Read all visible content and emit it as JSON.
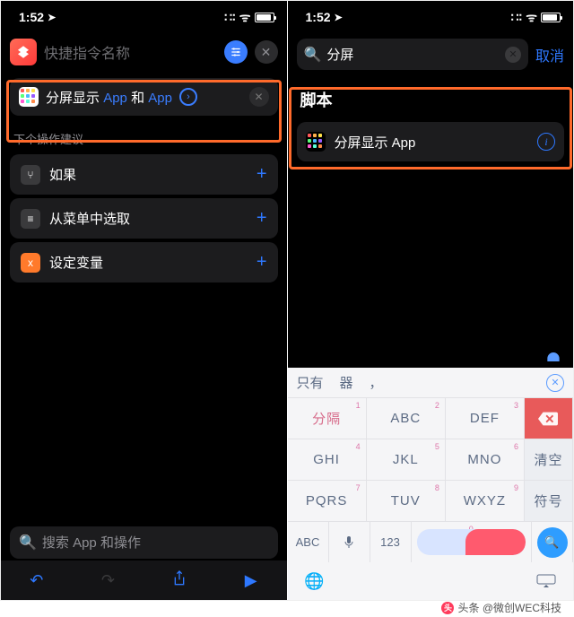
{
  "status": {
    "time": "1:52",
    "loc_icon": "➤"
  },
  "left": {
    "shortcut_name_placeholder": "快捷指令名称",
    "action": {
      "prefix": "分屏显示",
      "token": "App",
      "join": "和"
    },
    "suggest_label": "下个操作建议",
    "suggestions": [
      {
        "label": "如果",
        "color": "#3a3a3c"
      },
      {
        "label": "从菜单中选取",
        "color": "#3a3a3c"
      },
      {
        "label": "设定变量",
        "color": "#ff7a2b"
      }
    ],
    "search_placeholder": "搜索 App 和操作"
  },
  "right": {
    "search_value": "分屏",
    "cancel": "取消",
    "category": "脚本",
    "result": "分屏显示 App",
    "candidates": [
      "只有",
      "器",
      "，"
    ],
    "keys_row1": [
      {
        "num": "1",
        "main": "分隔",
        "pink": true
      },
      {
        "num": "2",
        "main": "ABC"
      },
      {
        "num": "3",
        "main": "DEF"
      }
    ],
    "keys_row2": [
      {
        "num": "4",
        "main": "GHI"
      },
      {
        "num": "5",
        "main": "JKL"
      },
      {
        "num": "6",
        "main": "MNO"
      }
    ],
    "side2": "清空",
    "keys_row3": [
      {
        "num": "7",
        "main": "PQRS"
      },
      {
        "num": "8",
        "main": "TUV"
      },
      {
        "num": "9",
        "main": "WXYZ"
      }
    ],
    "side3": "符号",
    "bottom": {
      "abc": "ABC",
      "num": "123",
      "zero": "0"
    }
  },
  "caption": "头条 @微创WEC科技"
}
